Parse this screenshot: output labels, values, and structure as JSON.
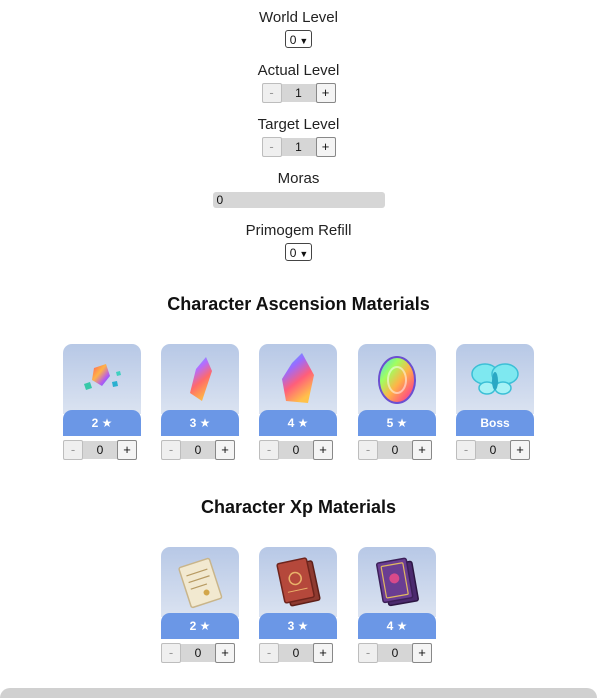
{
  "world_level": {
    "label": "World Level",
    "value": "0"
  },
  "actual_level": {
    "label": "Actual Level",
    "value": "1",
    "minus": "-",
    "plus": "+"
  },
  "target_level": {
    "label": "Target Level",
    "value": "1",
    "minus": "-",
    "plus": "+"
  },
  "moras": {
    "label": "Moras",
    "value": "0"
  },
  "primogem_refill": {
    "label": "Primogem Refill",
    "value": "0"
  },
  "ascension": {
    "title": "Character Ascension Materials",
    "items": [
      {
        "label": "2 ★",
        "value": "0",
        "minus": "-",
        "plus": "+",
        "icon": "gem-fragments-icon"
      },
      {
        "label": "3 ★",
        "value": "0",
        "minus": "-",
        "plus": "+",
        "icon": "gem-shard-icon"
      },
      {
        "label": "4 ★",
        "value": "0",
        "minus": "-",
        "plus": "+",
        "icon": "gem-chunk-icon"
      },
      {
        "label": "5 ★",
        "value": "0",
        "minus": "-",
        "plus": "+",
        "icon": "gem-gemstone-icon"
      },
      {
        "label": "Boss",
        "value": "0",
        "minus": "-",
        "plus": "+",
        "icon": "boss-material-icon"
      }
    ]
  },
  "xp": {
    "title": "Character Xp Materials",
    "items": [
      {
        "label": "2 ★",
        "value": "0",
        "minus": "-",
        "plus": "+",
        "icon": "xp-book-scroll-icon"
      },
      {
        "label": "3 ★",
        "value": "0",
        "minus": "-",
        "plus": "+",
        "icon": "xp-book-red-icon"
      },
      {
        "label": "4 ★",
        "value": "0",
        "minus": "-",
        "plus": "+",
        "icon": "xp-book-purple-icon"
      }
    ]
  }
}
